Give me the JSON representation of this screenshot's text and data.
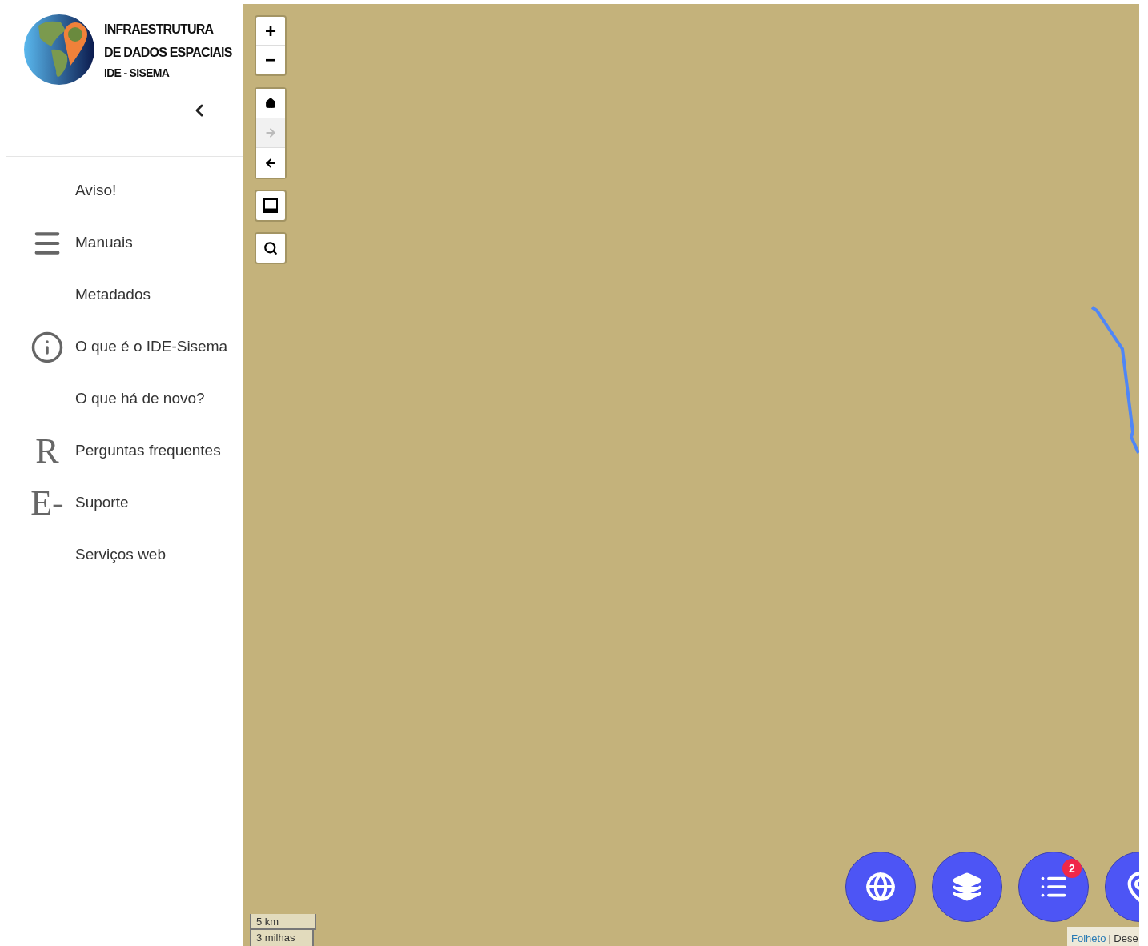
{
  "logo": {
    "title_lines": [
      "INFRAESTRUTURA",
      "DE DADOS ESPACIAIS"
    ],
    "subtitle": "IDE - SISEMA"
  },
  "menu": [
    {
      "label": "Aviso!",
      "kind": "none"
    },
    {
      "label": "Manuais",
      "kind": "menu"
    },
    {
      "label": "Metadados",
      "kind": "none"
    },
    {
      "label": "O que é o IDE-Sisema",
      "kind": "info"
    },
    {
      "label": "O que há de novo?",
      "kind": "none"
    },
    {
      "label": "Perguntas frequentes",
      "kind": "glyph",
      "glyph": "R"
    },
    {
      "label": "Suporte",
      "kind": "glyph",
      "glyph": "E-"
    },
    {
      "label": "Serviços web",
      "kind": "none"
    }
  ],
  "map_controls": {
    "zoom": [
      "+",
      "−"
    ],
    "history": [
      {
        "kind": "home",
        "disabled": false
      },
      {
        "kind": "forward",
        "disabled": true
      },
      {
        "kind": "back",
        "disabled": false
      }
    ],
    "tools": [
      {
        "kind": "measure"
      },
      {
        "kind": "search"
      }
    ]
  },
  "fab_buttons": [
    {
      "kind": "globe"
    },
    {
      "kind": "layers"
    },
    {
      "kind": "legend",
      "badge": "2"
    },
    {
      "kind": "pin"
    }
  ],
  "scale": [
    "5 km",
    "3 milhas"
  ],
  "attribution": {
    "link": "Folheto",
    "rest": "| Dese"
  }
}
